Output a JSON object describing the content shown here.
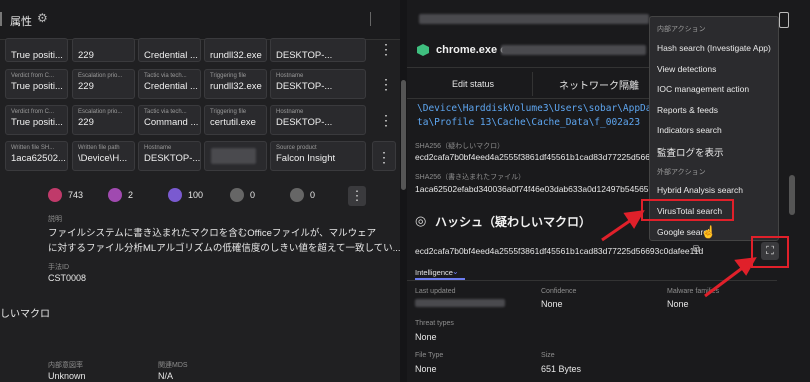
{
  "left": {
    "header_title": "属性",
    "rows": [
      {
        "cells": [
          {
            "label": "",
            "value": "True positi..."
          },
          {
            "label": "",
            "value": "229"
          },
          {
            "label": "",
            "value": "Credential ..."
          },
          {
            "label": "",
            "value": "rundll32.exe"
          },
          {
            "label": "",
            "value": "DESKTOP-..."
          }
        ]
      },
      {
        "cells": [
          {
            "label": "Verdict from C...",
            "value": "True positi..."
          },
          {
            "label": "Escalation prio...",
            "value": "229"
          },
          {
            "label": "Tactic via tech...",
            "value": "Credential ..."
          },
          {
            "label": "Triggering file",
            "value": "rundll32.exe"
          },
          {
            "label": "Hostname",
            "value": "DESKTOP-..."
          }
        ]
      },
      {
        "cells": [
          {
            "label": "Verdict from C...",
            "value": "True positi..."
          },
          {
            "label": "Escalation prio...",
            "value": "229"
          },
          {
            "label": "Tactic via tech...",
            "value": "Command ..."
          },
          {
            "label": "Triggering file",
            "value": "certutil.exe"
          },
          {
            "label": "Hostname",
            "value": "DESKTOP-..."
          }
        ]
      },
      {
        "cells": [
          {
            "label": "Written file SH...",
            "value": "1aca62502..."
          },
          {
            "label": "Written file path",
            "value": "\\Device\\H..."
          },
          {
            "label": "Hostname",
            "value": "DESKTOP-..."
          },
          {
            "label": "",
            "value": ""
          },
          {
            "label": "Source product",
            "value": "Falcon Insight"
          }
        ]
      }
    ],
    "stats": [
      "743",
      "2",
      "100",
      "0",
      "0"
    ],
    "desc_label": "説明",
    "desc_text_1": "ファイルシステムに書き込まれたマクロを含むOfficeファイルが、マルウェア",
    "desc_text_2": "に対するファイル分析MLアルゴリズムの低確信度のしきい値を超えて一致してい...",
    "method_label": "手法ID",
    "method_value": "CST0008",
    "side_title": "しいマクロ",
    "bottom_label_1": "内部意図率",
    "bottom_value_1": "Unknown",
    "bottom_label_2": "関連MDS",
    "bottom_value_2": "N/A"
  },
  "right": {
    "proc_title": "chrome.exe on",
    "edit_status": "Edit status",
    "network_isolate": "ネットワーク隔離",
    "path_1": "\\Device\\HarddiskVolume3\\Users\\sobar\\AppData\\Loca",
    "path_2": "ta\\Profile 13\\Cache\\Cache_Data\\f_002a23",
    "sha1_label": "SHA256（疑わしいマクロ）",
    "sha1_value": "ecd2cafa7b0bf4eed4a2555f3861df45561b1cad83d77225d56693c0",
    "sha2_label": "SHA256（書き込まれたファイル）",
    "sha2_value": "1aca62502efabd340036a0f74f46e03dab633a0d12497b5456590db",
    "hash_title": "ハッシュ（疑わしいマクロ）",
    "hash_value": "ecd2cafa7b0bf4eed4a2555f3861df45561b1cad83d77225d56693c0dafee11d",
    "intel_tab": "Intelligence",
    "last_updated_label": "Last updated",
    "confidence_label": "Confidence",
    "confidence_value": "None",
    "malware_label": "Malware families",
    "malware_value": "None",
    "threat_label": "Threat types",
    "threat_value": "None",
    "filetype_label": "File Type",
    "filetype_value": "None",
    "size_label": "Size",
    "size_value": "651 Bytes"
  },
  "menu": {
    "section_internal": "内部アクション",
    "items_internal": [
      "Hash search (Investigate App)",
      "View detections",
      "IOC management action",
      "Reports & feeds",
      "Indicators search",
      "監査ログを表示"
    ],
    "section_external": "外部アクション",
    "items_external": [
      "Hybrid Analysis search",
      "VirusTotal search",
      "Google search"
    ]
  },
  "colors": {
    "highlight": "#e0202a",
    "accent": "#6c7cf0"
  }
}
